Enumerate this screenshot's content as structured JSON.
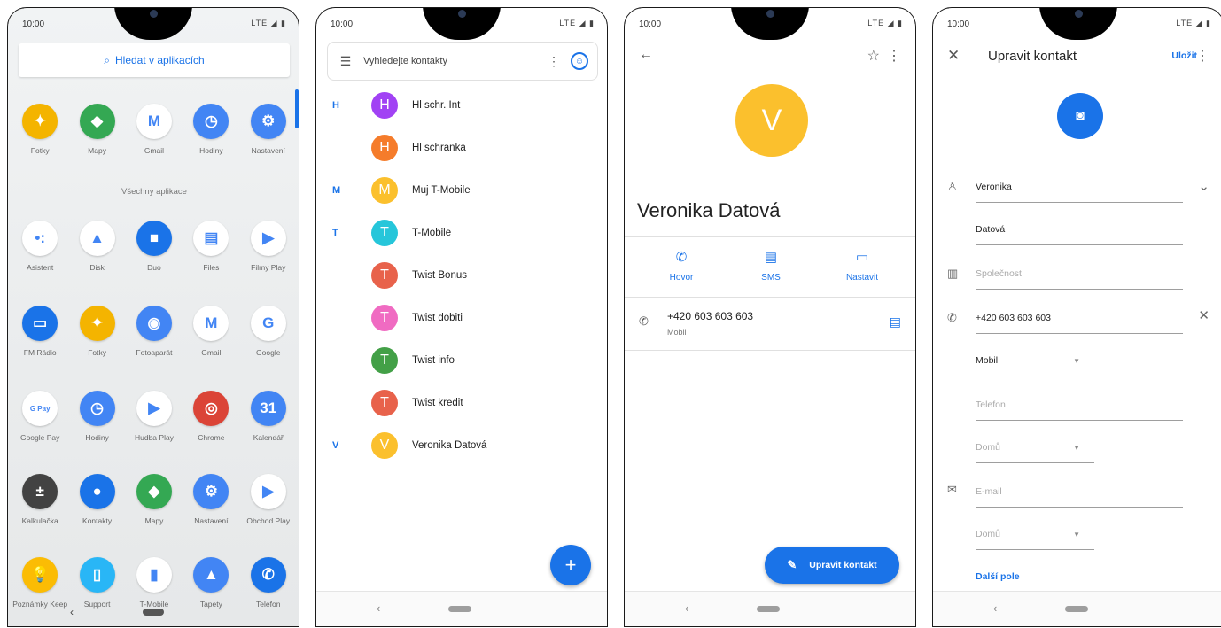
{
  "status": {
    "time": "10:00",
    "indicators": "LTE ◢ ▮"
  },
  "launcher": {
    "search_label": "Hledat v aplikacích",
    "section_title": "Všechny aplikace",
    "favorites": [
      {
        "label": "Fotky",
        "icon": "pinwheel-icon",
        "glyph": "✦",
        "color": "#f4b400"
      },
      {
        "label": "Mapy",
        "icon": "maps-icon",
        "glyph": "◆",
        "color": "#34a853"
      },
      {
        "label": "Gmail",
        "icon": "gmail-icon",
        "glyph": "M",
        "color": "#ffffff"
      },
      {
        "label": "Hodiny",
        "icon": "clock-icon",
        "glyph": "◷",
        "color": "#4285f4"
      },
      {
        "label": "Nastavení",
        "icon": "settings-icon",
        "glyph": "⚙",
        "color": "#4285f4"
      }
    ],
    "rows": [
      [
        {
          "label": "Asistent",
          "icon": "assistant-icon",
          "glyph": "•:",
          "color": "#ffffff"
        },
        {
          "label": "Disk",
          "icon": "drive-icon",
          "glyph": "▲",
          "color": "#ffffff"
        },
        {
          "label": "Duo",
          "icon": "duo-icon",
          "glyph": "■",
          "color": "#1a73e8"
        },
        {
          "label": "Files",
          "icon": "files-icon",
          "glyph": "▤",
          "color": "#ffffff"
        },
        {
          "label": "Filmy Play",
          "icon": "play-movies-icon",
          "glyph": "▶",
          "color": "#ffffff"
        }
      ],
      [
        {
          "label": "FM Rádio",
          "icon": "radio-icon",
          "glyph": "▭",
          "color": "#1a73e8"
        },
        {
          "label": "Fotky",
          "icon": "pinwheel-icon",
          "glyph": "✦",
          "color": "#f4b400"
        },
        {
          "label": "Fotoaparát",
          "icon": "camera-icon",
          "glyph": "◉",
          "color": "#4285f4"
        },
        {
          "label": "Gmail",
          "icon": "gmail-icon",
          "glyph": "M",
          "color": "#ffffff"
        },
        {
          "label": "Google",
          "icon": "google-icon",
          "glyph": "G",
          "color": "#ffffff"
        }
      ],
      [
        {
          "label": "Google Pay",
          "icon": "gpay-icon",
          "glyph": "G Pay",
          "color": "#ffffff"
        },
        {
          "label": "Hodiny",
          "icon": "clock-icon",
          "glyph": "◷",
          "color": "#4285f4"
        },
        {
          "label": "Hudba Play",
          "icon": "play-music-icon",
          "glyph": "▶",
          "color": "#ffffff"
        },
        {
          "label": "Chrome",
          "icon": "chrome-icon",
          "glyph": "◎",
          "color": "#db4437"
        },
        {
          "label": "Kalendář",
          "icon": "calendar-icon",
          "glyph": "31",
          "color": "#4285f4"
        }
      ],
      [
        {
          "label": "Kalkulačka",
          "icon": "calculator-icon",
          "glyph": "±",
          "color": "#424242"
        },
        {
          "label": "Kontakty",
          "icon": "contacts-icon",
          "glyph": "●",
          "color": "#1a73e8"
        },
        {
          "label": "Mapy",
          "icon": "maps-icon",
          "glyph": "◆",
          "color": "#34a853"
        },
        {
          "label": "Nastavení",
          "icon": "settings-icon",
          "glyph": "⚙",
          "color": "#4285f4"
        },
        {
          "label": "Obchod Play",
          "icon": "play-store-icon",
          "glyph": "▶",
          "color": "#ffffff"
        }
      ],
      [
        {
          "label": "Poznámky Keep",
          "icon": "keep-icon",
          "glyph": "💡",
          "color": "#fbbc04"
        },
        {
          "label": "Support",
          "icon": "support-icon",
          "glyph": "▯",
          "color": "#29b6f6"
        },
        {
          "label": "T-Mobile",
          "icon": "tmobile-icon",
          "glyph": "▮",
          "color": "#ffffff"
        },
        {
          "label": "Tapety",
          "icon": "wallpapers-icon",
          "glyph": "▲",
          "color": "#4285f4"
        },
        {
          "label": "Telefon",
          "icon": "phone-icon",
          "glyph": "✆",
          "color": "#1a73e8"
        }
      ]
    ]
  },
  "contacts": {
    "search_placeholder": "Vyhledejte kontakty",
    "list": [
      {
        "letter": "H",
        "initial": "H",
        "name": "Hl schr. Int",
        "color": "#a142f4"
      },
      {
        "letter": "",
        "initial": "H",
        "name": "Hl schranka",
        "color": "#f57c2b"
      },
      {
        "letter": "M",
        "initial": "M",
        "name": "Muj T-Mobile",
        "color": "#fbc02d"
      },
      {
        "letter": "T",
        "initial": "T",
        "name": "T-Mobile",
        "color": "#26c6da"
      },
      {
        "letter": "",
        "initial": "T",
        "name": "Twist Bonus",
        "color": "#e8624b"
      },
      {
        "letter": "",
        "initial": "T",
        "name": "Twist dobiti",
        "color": "#f06bc2"
      },
      {
        "letter": "",
        "initial": "T",
        "name": "Twist info",
        "color": "#43a047"
      },
      {
        "letter": "",
        "initial": "T",
        "name": "Twist kredit",
        "color": "#e8624b"
      },
      {
        "letter": "V",
        "initial": "V",
        "name": "Veronika Datová",
        "color": "#fbc02d"
      }
    ],
    "fab_label": "+"
  },
  "detail": {
    "initial": "V",
    "name": "Veronika Datová",
    "actions": [
      {
        "label": "Hovor",
        "icon": "phone-icon",
        "glyph": "✆"
      },
      {
        "label": "SMS",
        "icon": "message-icon",
        "glyph": "▤"
      },
      {
        "label": "Nastavit",
        "icon": "video-icon",
        "glyph": "▭"
      }
    ],
    "phone_number": "+420 603 603 603",
    "phone_type": "Mobil",
    "edit_button": "Upravit kontakt"
  },
  "edit": {
    "title": "Upravit kontakt",
    "save": "Uložit",
    "first_name": "Veronika",
    "last_name": "Datová",
    "company_placeholder": "Společnost",
    "phone": "+420 603 603 603",
    "phone_type": "Mobil",
    "phone2_placeholder": "Telefon",
    "phone2_type": "Domů",
    "email_placeholder": "E-mail",
    "email_type": "Domů",
    "more_fields": "Další pole"
  }
}
